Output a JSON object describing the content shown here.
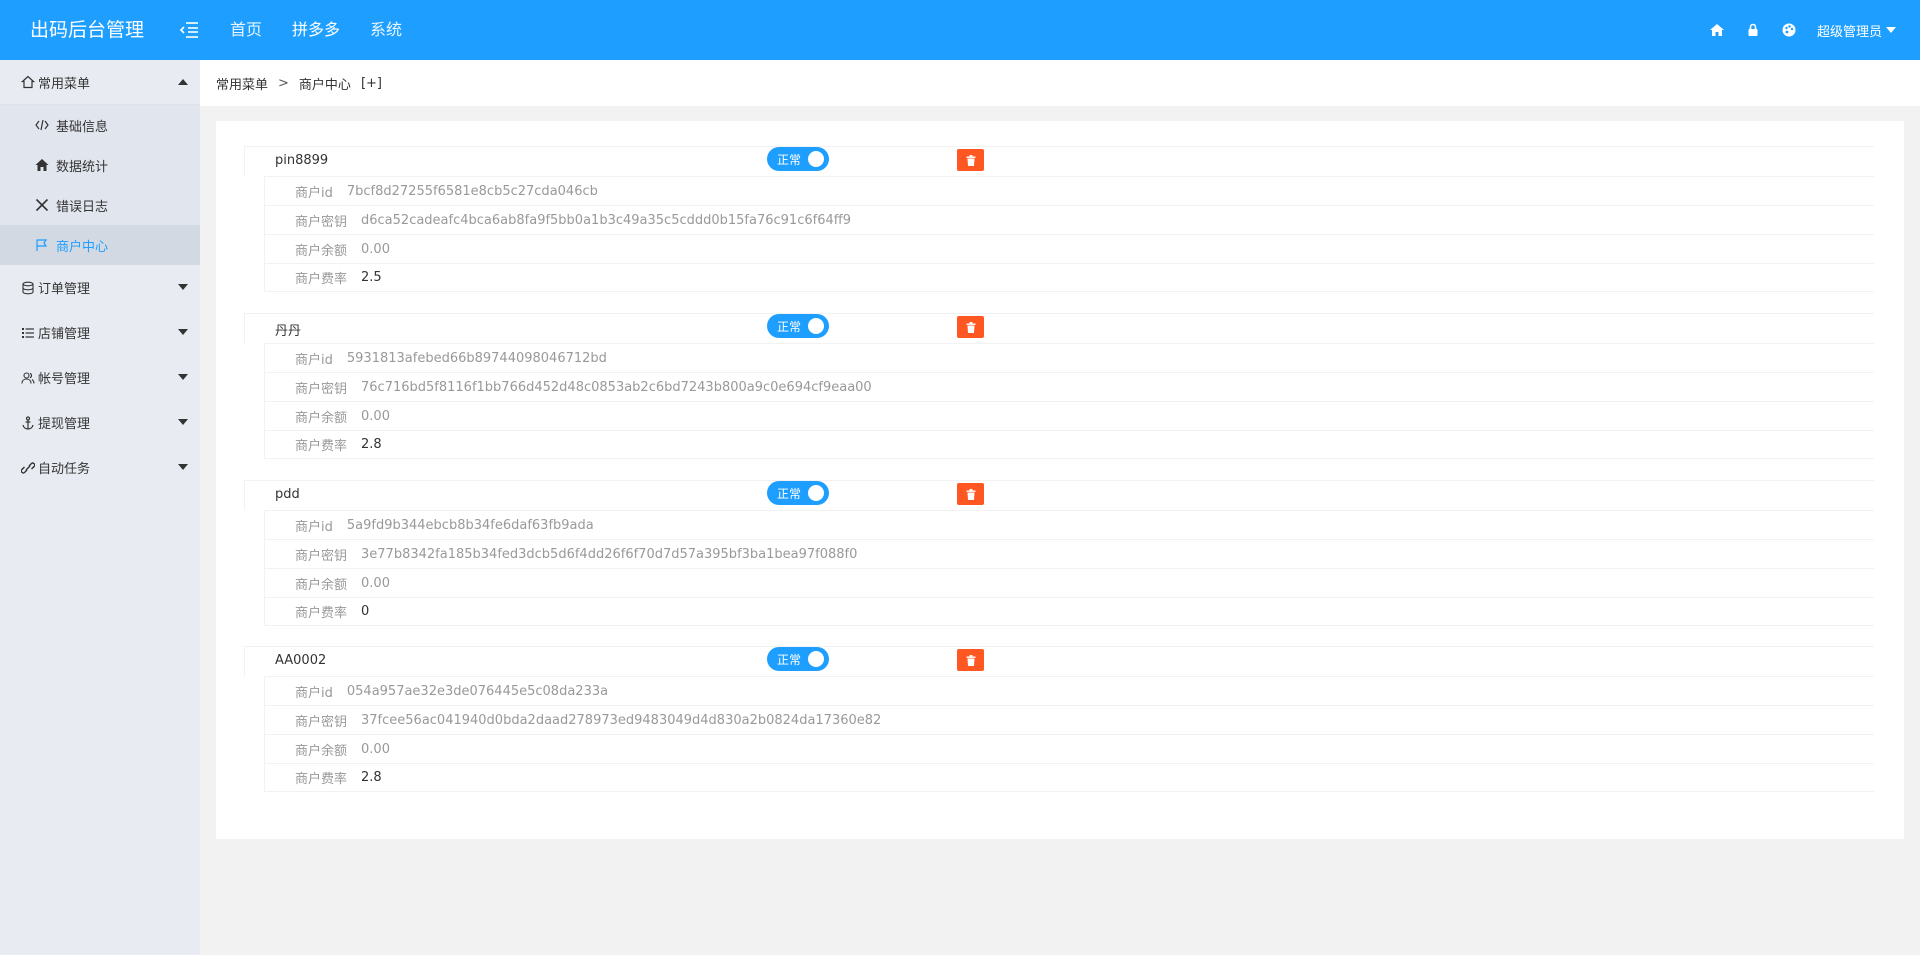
{
  "header": {
    "logo": "出码后台管理",
    "nav": [
      "首页",
      "拼多多",
      "系统"
    ],
    "user": "超级管理员",
    "accent": "#1e9fff"
  },
  "sidebar": {
    "groups": [
      {
        "label": "常用菜单",
        "icon": "home-outline-icon",
        "expanded": true,
        "items": [
          {
            "label": "基础信息",
            "icon": "code-icon"
          },
          {
            "label": "数据统计",
            "icon": "home-icon"
          },
          {
            "label": "错误日志",
            "icon": "close-icon"
          },
          {
            "label": "商户中心",
            "icon": "flag-icon",
            "active": true
          }
        ]
      },
      {
        "label": "订单管理",
        "icon": "database-icon"
      },
      {
        "label": "店铺管理",
        "icon": "list-icon"
      },
      {
        "label": "帐号管理",
        "icon": "users-icon"
      },
      {
        "label": "提现管理",
        "icon": "anchor-icon"
      },
      {
        "label": "自动任务",
        "icon": "link-icon"
      }
    ]
  },
  "breadcrumb": {
    "root": "常用菜单",
    "sep": ">",
    "current": "商户中心",
    "add": "[+]"
  },
  "labels": {
    "id": "商户id",
    "secret": "商户密钥",
    "balance": "商户余额",
    "rate": "商户费率",
    "status": "正常"
  },
  "merchants": [
    {
      "name": "pin8899",
      "id": "7bcf8d27255f6581e8cb5c27cda046cb",
      "secret": "d6ca52cadeafc4bca6ab8fa9f5bb0a1b3c49a35c5cddd0b15fa76c91c6f64ff9",
      "balance": "0.00",
      "rate": "2.5"
    },
    {
      "name": "丹丹",
      "id": "5931813afebed66b89744098046712bd",
      "secret": "76c716bd5f8116f1bb766d452d48c0853ab2c6bd7243b800a9c0e694cf9eaa00",
      "balance": "0.00",
      "rate": "2.8"
    },
    {
      "name": "pdd",
      "id": "5a9fd9b344ebcb8b34fe6daf63fb9ada",
      "secret": "3e77b8342fa185b34fed3dcb5d6f4dd26f6f70d7d57a395bf3ba1bea97f088f0",
      "balance": "0.00",
      "rate": "0"
    },
    {
      "name": "AA0002",
      "id": "054a957ae32e3de076445e5c08da233a",
      "secret": "37fcee56ac041940d0bda2daad278973ed9483049d4d830a2b0824da17360e82",
      "balance": "0.00",
      "rate": "2.8"
    }
  ]
}
